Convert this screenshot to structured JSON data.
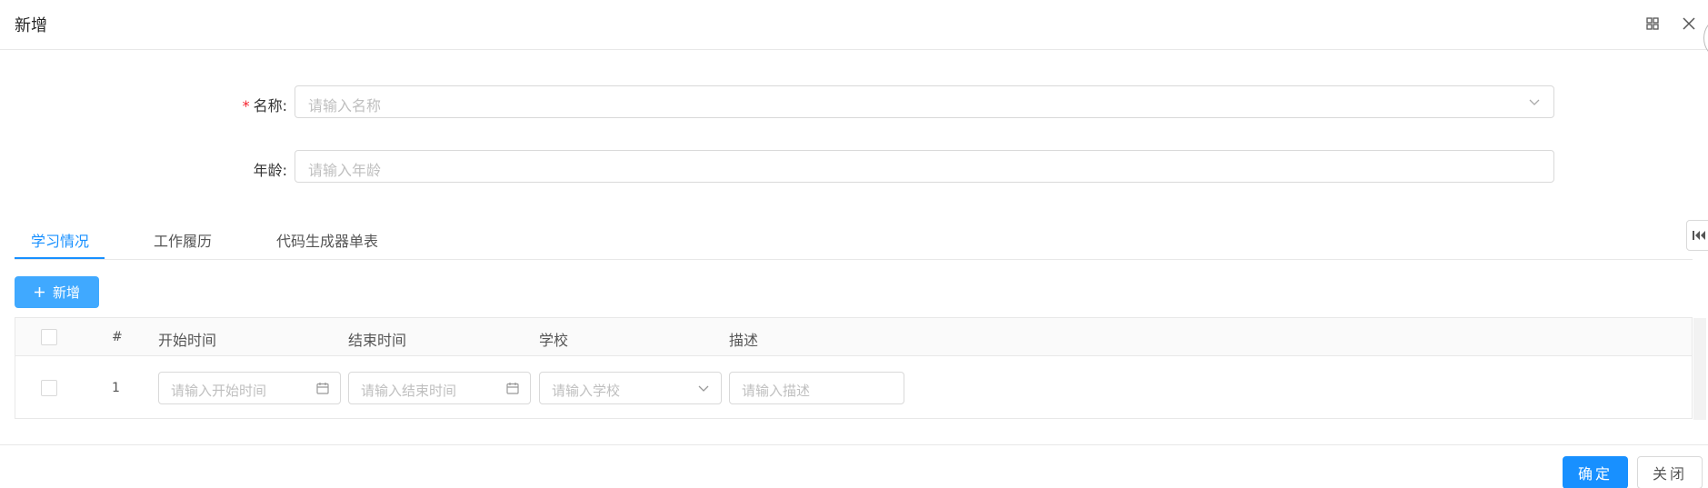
{
  "dialog": {
    "title": "新增"
  },
  "form": {
    "name": {
      "required_mark": "*",
      "label": "名称:",
      "placeholder": "请输入名称"
    },
    "age": {
      "label": "年龄:",
      "placeholder": "请输入年龄"
    }
  },
  "tabs": [
    {
      "label": "学习情况",
      "active": true
    },
    {
      "label": "工作履历",
      "active": false
    },
    {
      "label": "代码生成器单表",
      "active": false
    }
  ],
  "toolbar": {
    "add_label": "新增"
  },
  "table": {
    "columns": [
      "#",
      "开始时间",
      "结束时间",
      "学校",
      "描述"
    ],
    "rows": [
      {
        "index": "1",
        "start_placeholder": "请输入开始时间",
        "end_placeholder": "请输入结束时间",
        "school_placeholder": "请输入学校",
        "desc_placeholder": "请输入描述"
      }
    ]
  },
  "footer": {
    "ok_label": "确定",
    "close_label": "关闭"
  },
  "colors": {
    "primary": "#1890ff",
    "required": "#f5222d"
  },
  "icons": [
    "maximize-icon",
    "close-icon",
    "chevron-down-icon",
    "calendar-icon",
    "plus-icon",
    "collapse-left-icon"
  ]
}
